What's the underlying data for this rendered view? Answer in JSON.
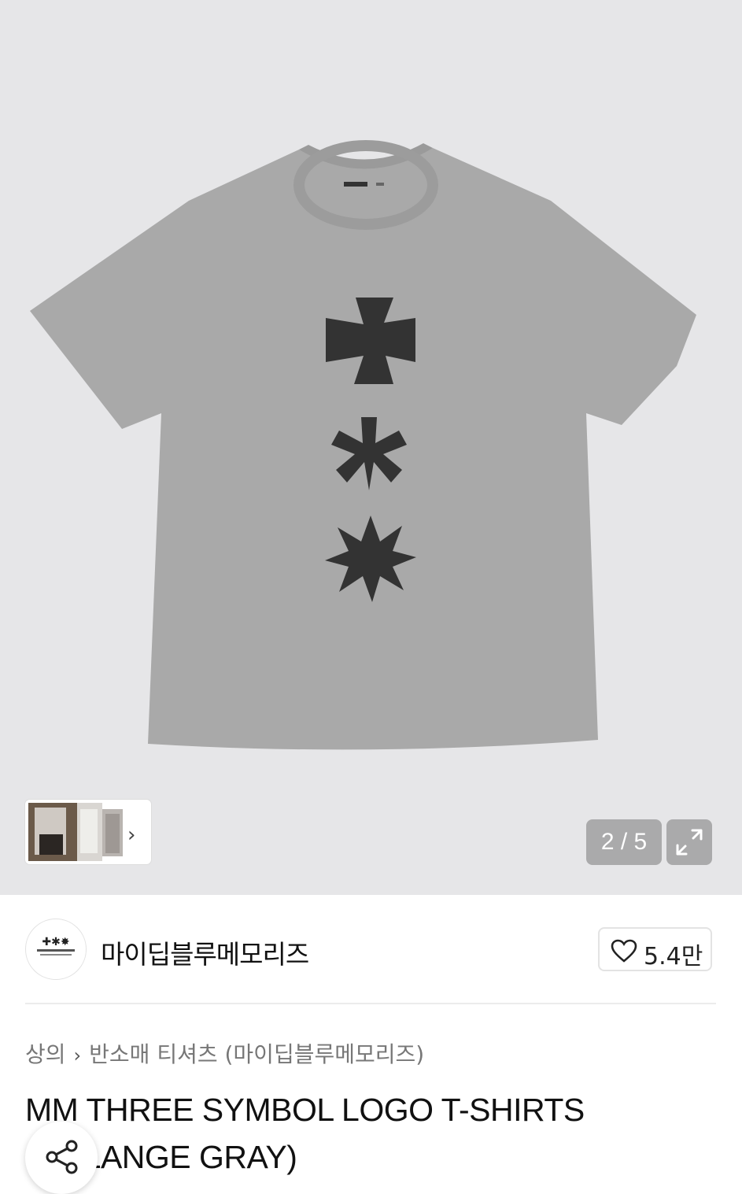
{
  "gallery": {
    "counter": "2 / 5",
    "colors": {
      "background": "#e6e6e8",
      "shirt": "#a9a9a9",
      "print": "#333333"
    },
    "thumbnail_strip": {
      "chevron": "›"
    },
    "expand_icon": "expand-icon"
  },
  "seller": {
    "name": "마이딥블루메모리즈",
    "avatar_icon": "brand-logo-icon",
    "like_count": "5.4만",
    "like_icon": "heart-icon"
  },
  "breadcrumb": {
    "root": "상의",
    "separator": "›",
    "category": "반소매 티셔츠 (마이딥블루메모리즈)"
  },
  "product": {
    "title": "MM THREE SYMBOL LOGO T-SHIRTS (MELANGE GRAY)"
  },
  "share": {
    "icon": "share-icon"
  }
}
